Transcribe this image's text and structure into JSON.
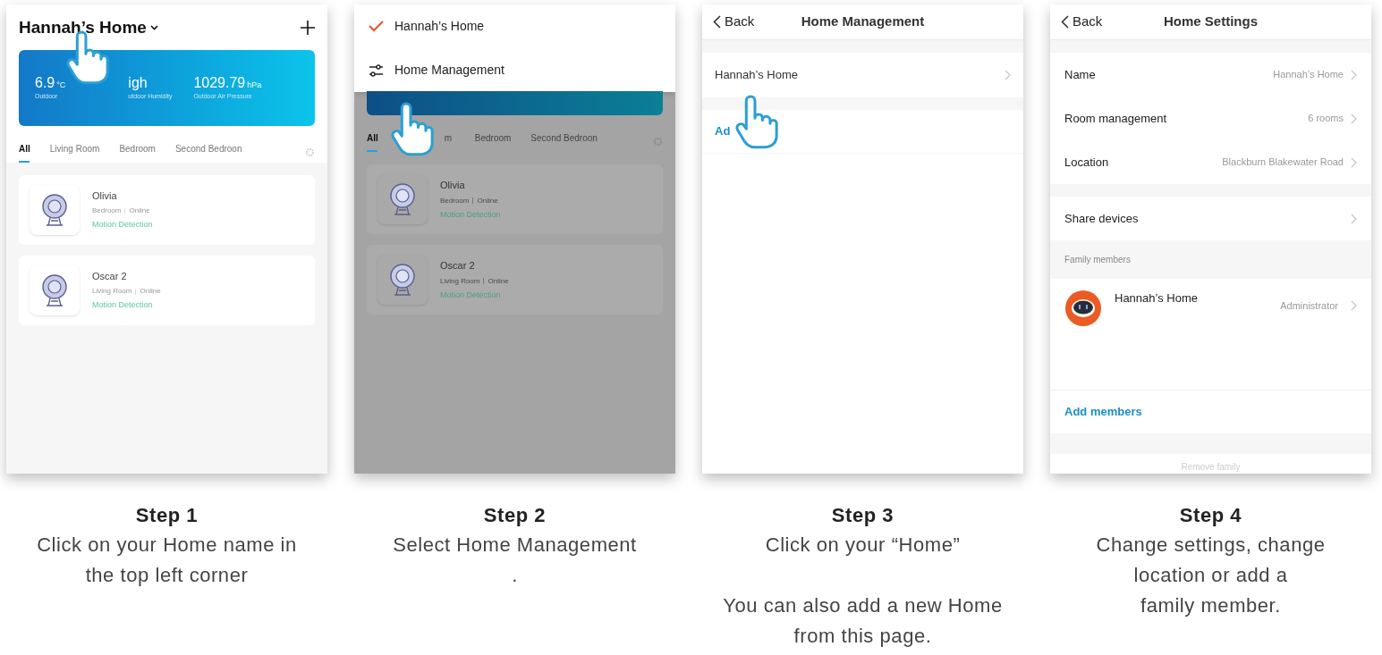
{
  "steps": [
    {
      "title": "Step 1",
      "caption": [
        [
          "Click on your Home name in",
          "the top left corner"
        ]
      ],
      "screen": {
        "kind": "home",
        "dimmed": false,
        "home_name": "Hannah’s Home",
        "weather": [
          {
            "value": "6.9",
            "unit": "°C",
            "label": "Outdoor"
          },
          {
            "value": "igh",
            "label": "utdoor Humidity"
          },
          {
            "value": "1029.79",
            "unit": "hPa",
            "label": "Outdoor Air Pressure"
          }
        ],
        "tabs": [
          {
            "label": "All",
            "selected": true
          },
          {
            "label": "Living Room",
            "selected": false
          },
          {
            "label": "Bedroom",
            "selected": false
          },
          {
            "label": "Second Bedroon",
            "selected": false
          }
        ],
        "devices": [
          {
            "name": "Olivia",
            "room": "Bedroom",
            "status": "Online",
            "mode": "Motion Detection"
          },
          {
            "name": "Oscar 2",
            "room": "Living Room",
            "status": "Online",
            "mode": "Motion Detection"
          }
        ]
      }
    },
    {
      "title": "Step 2",
      "caption": [
        [
          "Select Home Management",
          "."
        ]
      ],
      "screen": {
        "kind": "home",
        "dimmed": true,
        "menu": [
          {
            "kind": "home",
            "label": "Hannah’s Home",
            "checked": true
          },
          {
            "kind": "manage",
            "label": "Home Management"
          }
        ],
        "tabs": [
          {
            "label": "All",
            "selected": true
          },
          {
            "label": "m",
            "selected": false
          },
          {
            "label": "Bedroom",
            "selected": false
          },
          {
            "label": "Second Bedroon",
            "selected": false
          }
        ],
        "devices": [
          {
            "name": "Olivia",
            "room": "Bedroom",
            "status": "Online",
            "mode": "Motion Detection"
          },
          {
            "name": "Oscar 2",
            "room": "Living Room",
            "status": "Online",
            "mode": "Motion Detection"
          }
        ]
      }
    },
    {
      "title": "Step 3",
      "caption": [
        [
          "Click on your “Home”"
        ],
        [
          "You can also add a new Home",
          "from this page."
        ]
      ],
      "screen": {
        "kind": "management",
        "back": "Back",
        "title": "Home Management",
        "homes": [
          "Hannah’s Home"
        ],
        "add": "Ad"
      }
    },
    {
      "title": "Step 4",
      "caption": [
        [
          "Change settings, change",
          "location or add a",
          "family member."
        ]
      ],
      "screen": {
        "kind": "settings",
        "back": "Back",
        "title": "Home Settings",
        "groups": [
          [
            {
              "label": "Name",
              "value": "Hannah’s Home"
            },
            {
              "label": "Room management",
              "value": "6 rooms"
            },
            {
              "label": "Location",
              "value": "Blackburn Blakewater Road"
            }
          ],
          [
            {
              "label": "Share devices"
            }
          ]
        ],
        "section": "Family members",
        "members": [
          {
            "name": "Hannah’s Home",
            "role": "Administrator"
          }
        ],
        "add": "Add members",
        "remove": "Remove family"
      }
    }
  ]
}
